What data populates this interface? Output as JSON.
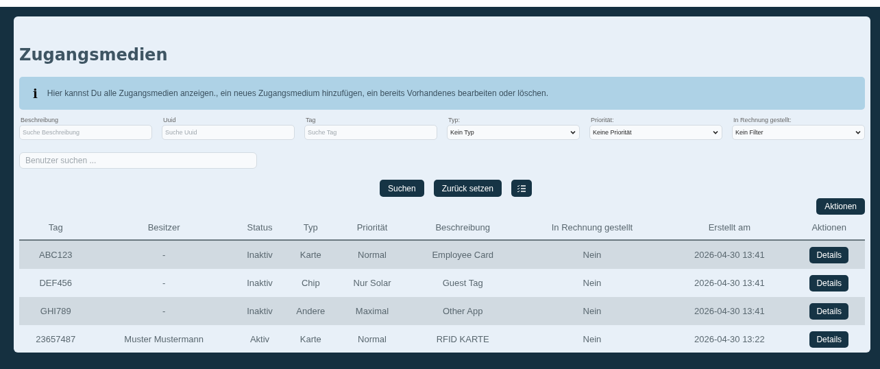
{
  "title": "Zugangsmedien",
  "info": {
    "icon": "i",
    "text": "Hier kannst Du alle Zugangsmedien anzeigen., ein neues Zugangsmedium hinzufügen, ein bereits Vorhandenes bearbeiten oder löschen."
  },
  "filters": [
    {
      "kind": "text",
      "label": "Beschreibung",
      "placeholder": "Suche Beschreibung"
    },
    {
      "kind": "text",
      "label": "Uuid",
      "placeholder": "Suche Uuid"
    },
    {
      "kind": "text",
      "label": "Tag",
      "placeholder": "Suche Tag"
    },
    {
      "kind": "select",
      "label": "Typ:",
      "value": "Kein Typ"
    },
    {
      "kind": "select",
      "label": "Priorität:",
      "value": "Keine Priorität"
    },
    {
      "kind": "select",
      "label": "In Rechnung gestellt:",
      "value": "Kein Filter"
    }
  ],
  "user_search": {
    "placeholder": "Benutzer suchen ..."
  },
  "buttons": [
    {
      "kind": "text",
      "label": "Suchen"
    },
    {
      "kind": "text",
      "label": "Zurück setzen"
    },
    {
      "kind": "icon"
    }
  ],
  "actions_button": "Aktionen",
  "table": {
    "columns": [
      "Tag",
      "Besitzer",
      "Status",
      "Typ",
      "Priorität",
      "Beschreibung",
      "In Rechnung gestellt",
      "Erstellt am",
      "Aktionen"
    ],
    "rows": [
      {
        "cells": [
          "ABC123",
          "-",
          "Inaktiv",
          "Karte",
          "Normal",
          "Employee Card",
          "Nein",
          "2026-04-30 13:41"
        ],
        "action": "Details"
      },
      {
        "cells": [
          "DEF456",
          "-",
          "Inaktiv",
          "Chip",
          "Nur Solar",
          "Guest Tag",
          "Nein",
          "2026-04-30 13:41"
        ],
        "action": "Details"
      },
      {
        "cells": [
          "GHI789",
          "-",
          "Inaktiv",
          "Andere",
          "Maximal",
          "Other App",
          "Nein",
          "2026-04-30 13:41"
        ],
        "action": "Details"
      },
      {
        "cells": [
          "23657487",
          "Muster Mustermann",
          "Aktiv",
          "Karte",
          "Normal",
          "RFID KARTE",
          "Nein",
          "2026-04-30 13:22"
        ],
        "action": "Details"
      }
    ]
  }
}
